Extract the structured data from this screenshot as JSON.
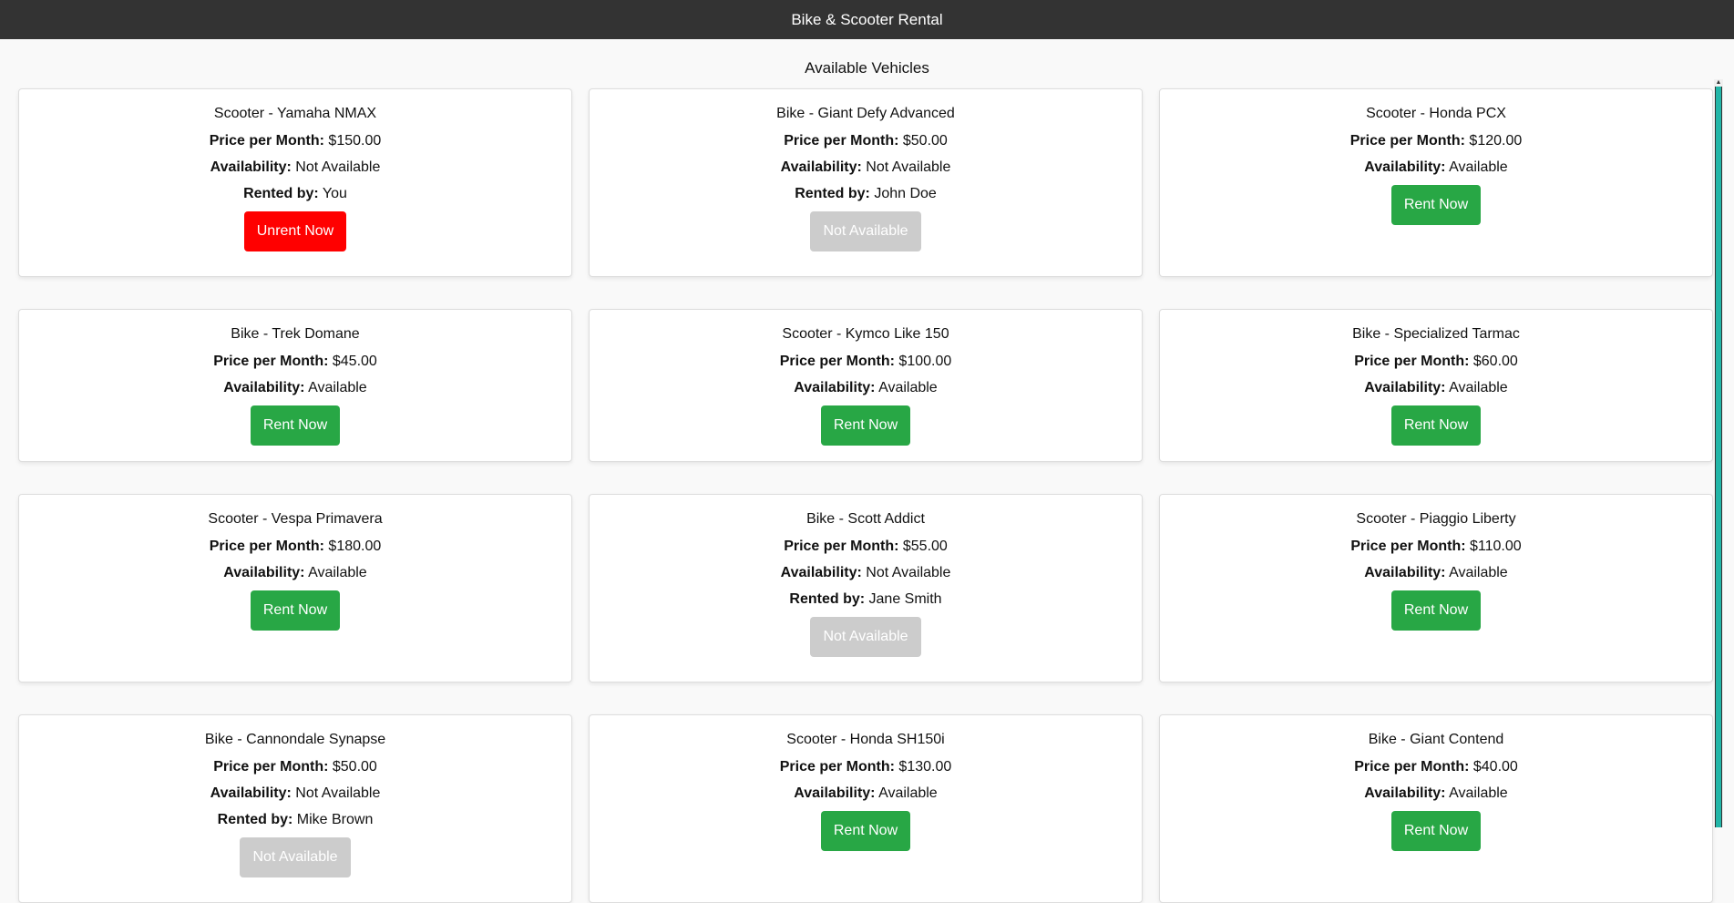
{
  "header": {
    "title": "Bike & Scooter Rental"
  },
  "main": {
    "heading": "Available Vehicles"
  },
  "labels": {
    "price": "Price per Month:",
    "availability": "Availability:",
    "rented_by": "Rented by:"
  },
  "colors": {
    "header_bg": "#333333",
    "rent": "#28a745",
    "unrent": "#ff0000",
    "disabled": "#cccccc",
    "scroll_thumb": "#22b6a8"
  },
  "vehicles": [
    {
      "name": "Scooter - Yamaha NMAX",
      "price": "$150.00",
      "availability": "Not Available",
      "rented_by": "You",
      "button": "Unrent Now",
      "button_type": "unrent"
    },
    {
      "name": "Bike - Giant Defy Advanced",
      "price": "$50.00",
      "availability": "Not Available",
      "rented_by": "John Doe",
      "button": "Not Available",
      "button_type": "na"
    },
    {
      "name": "Scooter - Honda PCX",
      "price": "$120.00",
      "availability": "Available",
      "rented_by": null,
      "button": "Rent Now",
      "button_type": "rent"
    },
    {
      "name": "Bike - Trek Domane",
      "price": "$45.00",
      "availability": "Available",
      "rented_by": null,
      "button": "Rent Now",
      "button_type": "rent"
    },
    {
      "name": "Scooter - Kymco Like 150",
      "price": "$100.00",
      "availability": "Available",
      "rented_by": null,
      "button": "Rent Now",
      "button_type": "rent"
    },
    {
      "name": "Bike - Specialized Tarmac",
      "price": "$60.00",
      "availability": "Available",
      "rented_by": null,
      "button": "Rent Now",
      "button_type": "rent"
    },
    {
      "name": "Scooter - Vespa Primavera",
      "price": "$180.00",
      "availability": "Available",
      "rented_by": null,
      "button": "Rent Now",
      "button_type": "rent"
    },
    {
      "name": "Bike - Scott Addict",
      "price": "$55.00",
      "availability": "Not Available",
      "rented_by": "Jane Smith",
      "button": "Not Available",
      "button_type": "na"
    },
    {
      "name": "Scooter - Piaggio Liberty",
      "price": "$110.00",
      "availability": "Available",
      "rented_by": null,
      "button": "Rent Now",
      "button_type": "rent"
    },
    {
      "name": "Bike - Cannondale Synapse",
      "price": "$50.00",
      "availability": "Not Available",
      "rented_by": "Mike Brown",
      "button": "Not Available",
      "button_type": "na"
    },
    {
      "name": "Scooter - Honda SH150i",
      "price": "$130.00",
      "availability": "Available",
      "rented_by": null,
      "button": "Rent Now",
      "button_type": "rent"
    },
    {
      "name": "Bike - Giant Contend",
      "price": "$40.00",
      "availability": "Available",
      "rented_by": null,
      "button": "Rent Now",
      "button_type": "rent"
    }
  ]
}
